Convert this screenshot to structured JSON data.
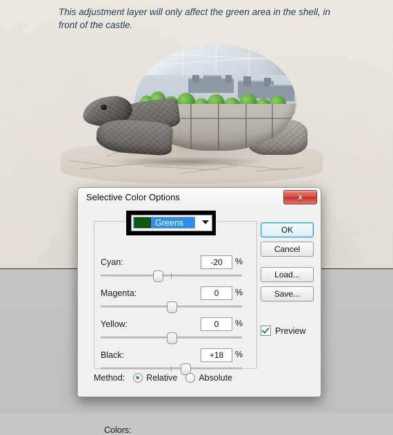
{
  "caption": {
    "text": "This adjustment layer will only affect the green area in the shell, in front of the castle."
  },
  "artwork": {
    "name": "tortoise-castle-composite",
    "description": "Stone textured giant tortoise with a castle and green trees composited onto its shell, standing on cracked dry ground"
  },
  "dialog": {
    "title": "Selective Color Options",
    "close_label": "x",
    "color_label": "Colors:",
    "color_value": "Greens",
    "color_swatch_hex": "#0a5c0a",
    "selection_hex": "#2a8fef",
    "sliders": [
      {
        "label": "Cyan:",
        "value": "-20",
        "unit": "%",
        "percent": 40
      },
      {
        "label": "Magenta:",
        "value": "0",
        "unit": "%",
        "percent": 50
      },
      {
        "label": "Yellow:",
        "value": "0",
        "unit": "%",
        "percent": 50
      },
      {
        "label": "Black:",
        "value": "+18",
        "unit": "%",
        "percent": 59
      }
    ],
    "method_label": "Method:",
    "method_options": [
      {
        "label": "Relative",
        "selected": true
      },
      {
        "label": "Absolute",
        "selected": false
      }
    ],
    "buttons": [
      {
        "label": "OK",
        "default": true
      },
      {
        "label": "Cancel",
        "default": false
      },
      {
        "label": "Load...",
        "default": false
      },
      {
        "label": "Save...",
        "default": false
      }
    ],
    "preview": {
      "label": "Preview",
      "checked": true
    }
  }
}
